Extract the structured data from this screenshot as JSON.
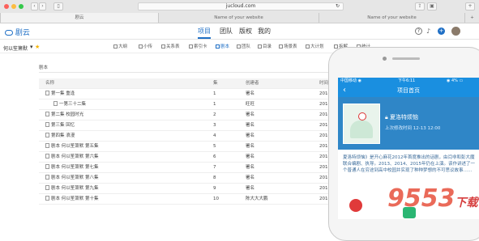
{
  "browser": {
    "url": "jucloud.com",
    "tabs": [
      "剧云",
      "Name of your website",
      "Name of your website"
    ],
    "new_tab": "+"
  },
  "app": {
    "logo": "剧云",
    "nav": [
      "项目",
      "团队",
      "版权",
      "我的"
    ],
    "header_icons": [
      "help-icon",
      "bell-icon",
      "plus-icon",
      "avatar"
    ]
  },
  "project": {
    "name": "何以笙箫默",
    "star": "★",
    "tools": [
      "大纲",
      "小传",
      "关系表",
      "索引卡",
      "剧本",
      "团队",
      "目录",
      "场景表",
      "大计划",
      "拆解",
      "统计"
    ]
  },
  "breadcrumb": "剧本",
  "table": {
    "headers": [
      "名称",
      "集",
      "创建者",
      "时间"
    ],
    "rows": [
      [
        "第一集 重逢",
        "1",
        "署名",
        "2016"
      ],
      [
        "一第三十二集",
        "1",
        "旺旺",
        "2016"
      ],
      [
        "第二集 校园时光",
        "2",
        "署名",
        "2016"
      ],
      [
        "第三集 回忆",
        "3",
        "署名",
        "2016"
      ],
      [
        "第四集 浪漫",
        "4",
        "署名",
        "2016"
      ],
      [
        "剧本 何以笙箫默 第五集",
        "5",
        "署名",
        "2016"
      ],
      [
        "剧本 何以笙箫默 第六集",
        "6",
        "署名",
        "2016"
      ],
      [
        "剧本 何以笙箫默 第七集",
        "7",
        "署名",
        "2016"
      ],
      [
        "剧本 何以笙箫默 第八集",
        "8",
        "署名",
        "2016"
      ],
      [
        "剧本 何以笙箫默 第九集",
        "9",
        "署名",
        "2016"
      ],
      [
        "剧本 何以笙箫默 第十集",
        "10",
        "陈大大大鹏",
        "2016"
      ]
    ]
  },
  "phone": {
    "carrier": "中国移动 ◉",
    "time": "下午6:11",
    "battery": "◉ 4% ▭",
    "header_title": "项目首页",
    "back": "‹",
    "project_title": "夏洛特烦恼",
    "edit_label": "上次修改时间",
    "edit_date": "12-13 12:00",
    "description": "夏洛特烦恼》是开心麻花2012年首度推出的话剧，由闫非和彭大魔联合编剧、执导。2013、2014、2015年仍在上演。该作讲述了一个普通人在穷途到高中校园并实现了种种梦想的不可思议故事……"
  },
  "watermark": {
    "text": "9553",
    "sub": "下载"
  },
  "colors": {
    "accent": "#1f6fc5",
    "phone_blue": "#1a8fe0"
  }
}
